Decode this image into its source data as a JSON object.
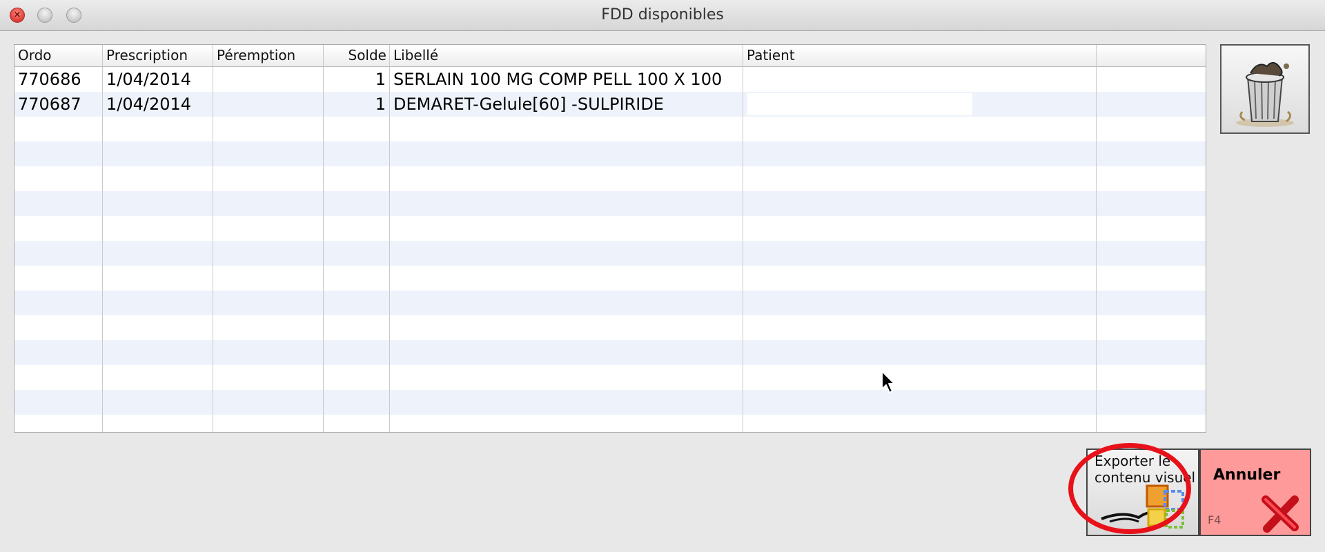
{
  "window": {
    "title": "FDD disponibles"
  },
  "table": {
    "columns": [
      "Ordo",
      "Prescription",
      "Péremption",
      "Solde",
      "Libellé",
      "Patient",
      ""
    ],
    "rows": [
      {
        "ordo": "770686",
        "prescription": "1/04/2014",
        "peremption": "",
        "solde": "1",
        "libelle": "SERLAIN 100 MG COMP PELL 100 X 100",
        "patient": ""
      },
      {
        "ordo": "770687",
        "prescription": "1/04/2014",
        "peremption": "",
        "solde": "1",
        "libelle": "DEMARET-Gelule[60] -SULPIRIDE",
        "patient": ""
      }
    ]
  },
  "buttons": {
    "trash_icon": "trash-can-icon",
    "export_label": "Exporter le contenu visuel",
    "export_icon": "office-export-icon",
    "cancel_label": "Annuler",
    "cancel_shortcut": "F4",
    "cancel_icon": "red-x-icon"
  },
  "colors": {
    "cancel_background": "#ff9a9a",
    "highlight_circle": "#e8111a",
    "row_stripe": "#eef3fb"
  }
}
